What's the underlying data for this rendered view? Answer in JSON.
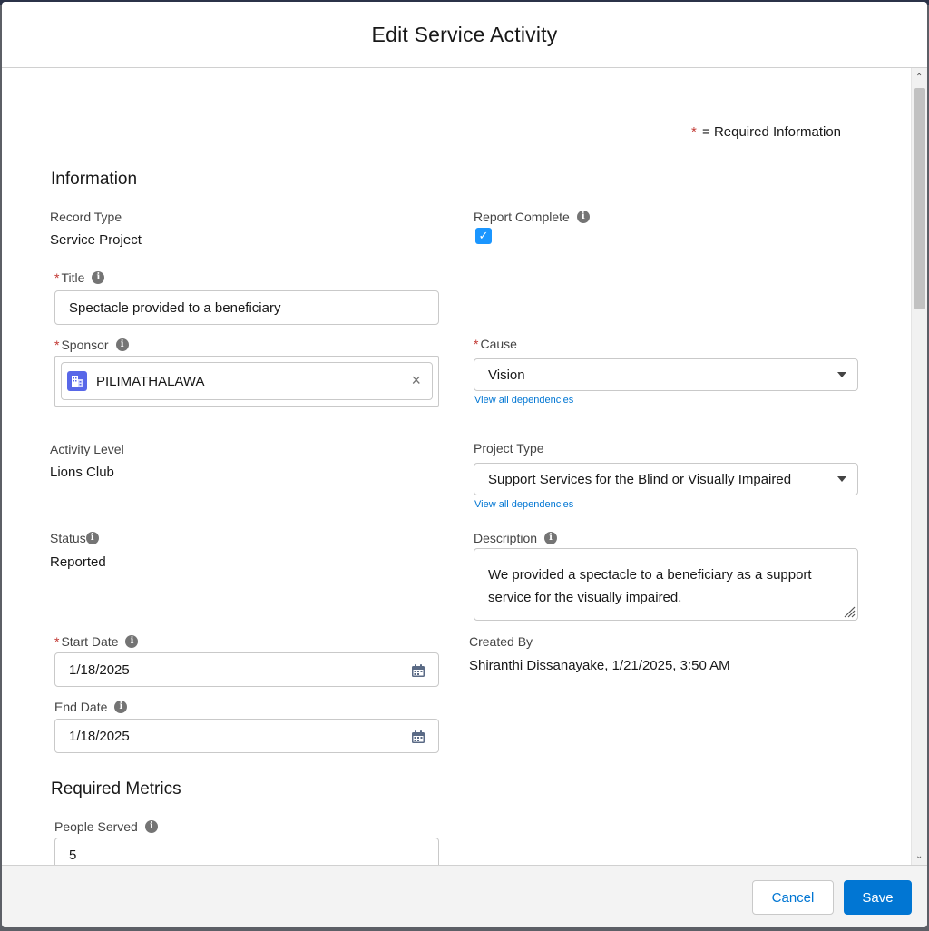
{
  "modal": {
    "title": "Edit Service Activity"
  },
  "legend": {
    "star": "*",
    "text": "= Required Information"
  },
  "sections": {
    "information": "Information",
    "required_metrics": "Required Metrics"
  },
  "fields": {
    "record_type": {
      "label": "Record Type",
      "value": "Service Project"
    },
    "report_complete": {
      "label": "Report Complete",
      "checked": true,
      "check_glyph": "✓"
    },
    "title": {
      "star": "*",
      "label": "Title",
      "value": "Spectacle provided to a beneficiary"
    },
    "sponsor": {
      "star": "*",
      "label": "Sponsor",
      "value": "PILIMATHALAWA",
      "clear_glyph": "×"
    },
    "cause": {
      "star": "*",
      "label": "Cause",
      "value": "Vision",
      "link": "View all dependencies"
    },
    "activity_level": {
      "label": "Activity Level",
      "value": "Lions Club"
    },
    "project_type": {
      "label": "Project Type",
      "value": "Support Services for the Blind or Visually Impaired",
      "link": "View all dependencies"
    },
    "status": {
      "label": "Status",
      "value": "Reported"
    },
    "description": {
      "label": "Description",
      "value": "We provided a spectacle to a beneficiary as a support service for the visually impaired."
    },
    "start_date": {
      "star": "*",
      "label": "Start Date",
      "value": "1/18/2025"
    },
    "end_date": {
      "label": "End Date",
      "value": "1/18/2025"
    },
    "created_by": {
      "label": "Created By",
      "value": "Shiranthi Dissanayake, 1/21/2025, 3:50 AM"
    },
    "people_served": {
      "label": "People Served",
      "value": "5"
    }
  },
  "footer": {
    "cancel": "Cancel",
    "save": "Save"
  },
  "icons": {
    "info": "info-icon",
    "calendar": "calendar-icon",
    "account": "account-icon",
    "close": "close-icon",
    "chevron": "chevron-down-icon",
    "check": "checkmark-icon"
  },
  "colors": {
    "brand": "#0176d3",
    "required": "#c23934",
    "checkbox": "#1b96ff",
    "account_icon": "#5867e8"
  },
  "scrollbar": {
    "position_fraction": 0.0
  }
}
